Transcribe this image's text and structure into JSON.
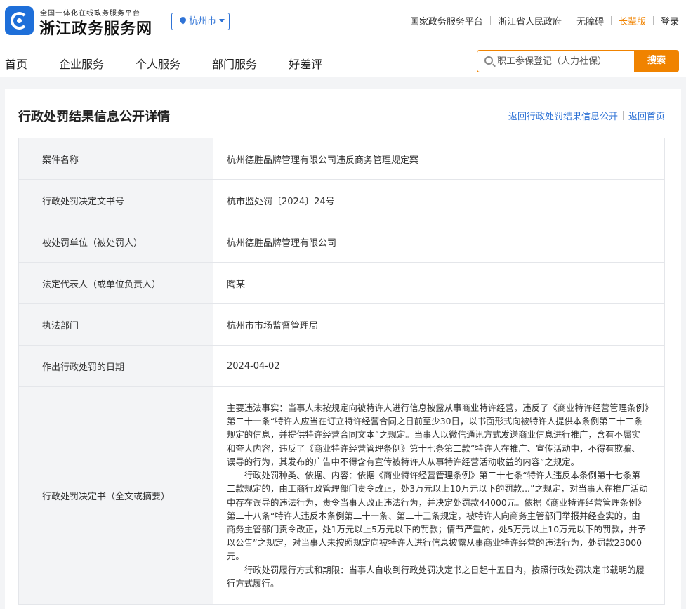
{
  "header": {
    "logo_subtitle": "全国一体化在线政务服务平台",
    "logo_title": "浙江政务服务网",
    "city": "杭州市",
    "top_links": [
      "国家政务服务平台",
      "浙江省人民政府",
      "无障碍",
      "长辈版",
      "登录"
    ],
    "nav": [
      "首页",
      "企业服务",
      "个人服务",
      "部门服务",
      "好差评"
    ],
    "search_placeholder": "职工参保登记（人力社保）",
    "search_button": "搜索"
  },
  "page": {
    "title": "行政处罚结果信息公开详情",
    "link_back_list": "返回行政处罚结果信息公开",
    "link_back_home": "返回首页"
  },
  "details": {
    "rows": [
      {
        "label": "案件名称",
        "value": "杭州德胜品牌管理有限公司违反商务管理规定案"
      },
      {
        "label": "行政处罚决定文书号",
        "value": "杭市监处罚〔2024〕24号"
      },
      {
        "label": "被处罚单位（被处罚人）",
        "value": "杭州德胜品牌管理有限公司"
      },
      {
        "label": "法定代表人（或单位负责人）",
        "value": "陶某"
      },
      {
        "label": "执法部门",
        "value": "杭州市市场监督管理局"
      },
      {
        "label": "作出行政处罚的日期",
        "value": "2024-04-02"
      }
    ],
    "decision_label": "行政处罚决定书（全文或摘要）",
    "decision_paragraphs": [
      "主要违法事实：当事人未按规定向被特许人进行信息披露从事商业特许经营，违反了《商业特许经营管理条例》第二十一条“特许人应当在订立特许经营合同之日前至少30日，以书面形式向被特许人提供本条例第二十二条规定的信息，并提供特许经营合同文本”之规定。当事人以微信通讯方式发送商业信息进行推广，含有不属实和夸大内容，违反了《商业特许经营管理条例》第十七条第二款“特许人在推广、宣传活动中，不得有欺骗、误导的行为，其发布的广告中不得含有宣传被特许人从事特许经营活动收益的内容”之规定。",
      "行政处罚种类、依据、内容：依据《商业特许经营管理条例》第二十七条“特许人违反本条例第十七条第二款规定的，由工商行政管理部门责令改正，处3万元以上10万元以下的罚款...”之规定，对当事人在推广活动中存在误导的违法行为，责令当事人改正违法行为，并决定处罚款44000元。依据《商业特许经营管理条例》第二十八条“特许人违反本条例第二十一条、第二十三条规定，被特许人向商务主管部门举报并经查实的，由商务主管部门责令改正，处1万元以上5万元以下的罚款；情节严重的，处5万元以上10万元以下的罚款，并予以公告”之规定，对当事人未按照规定向被特许人进行信息披露从事商业特许经营的违法行为，处罚款23000元。",
      "行政处罚履行方式和期限：当事人自收到行政处罚决定书之日起十五日内，按照行政处罚决定书载明的履行方式履行。"
    ]
  }
}
